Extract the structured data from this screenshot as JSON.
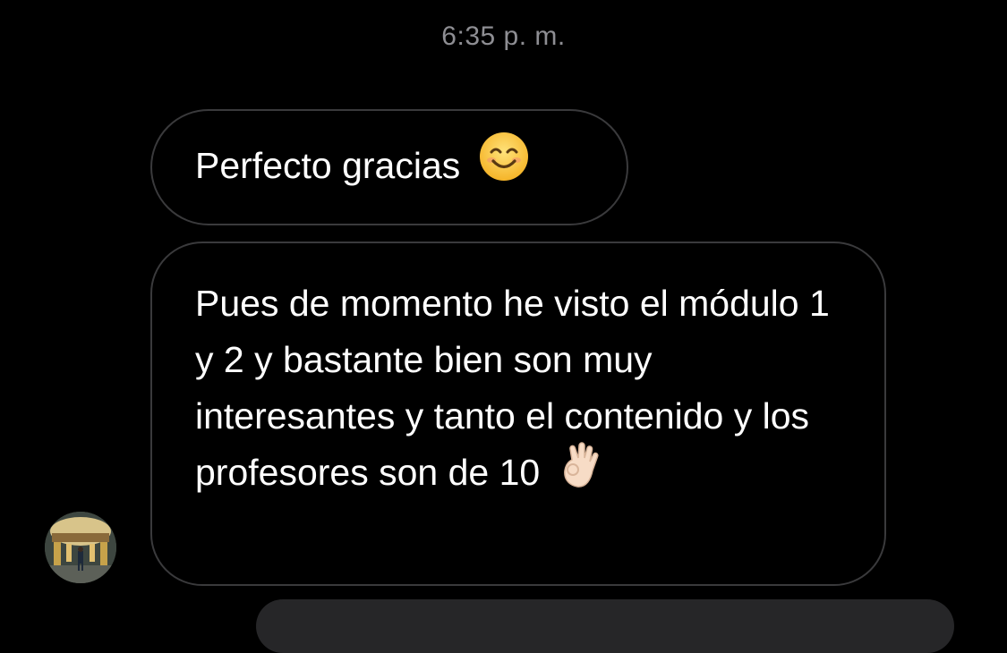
{
  "conversation": {
    "timestamp": "6:35 p. m.",
    "messages": [
      {
        "text": "Perfecto gracias",
        "emoji": "smiling-face-icon"
      },
      {
        "text": "Pues de momento he visto el módulo 1 y 2 y bastante bien son muy interesantes y tanto el contenido y los profesores son de 10",
        "emoji": "ok-hand-icon"
      }
    ]
  },
  "colors": {
    "background": "#000000",
    "bubble_border": "#3a3a3c",
    "timestamp": "#8e8e93",
    "text": "#ffffff"
  }
}
